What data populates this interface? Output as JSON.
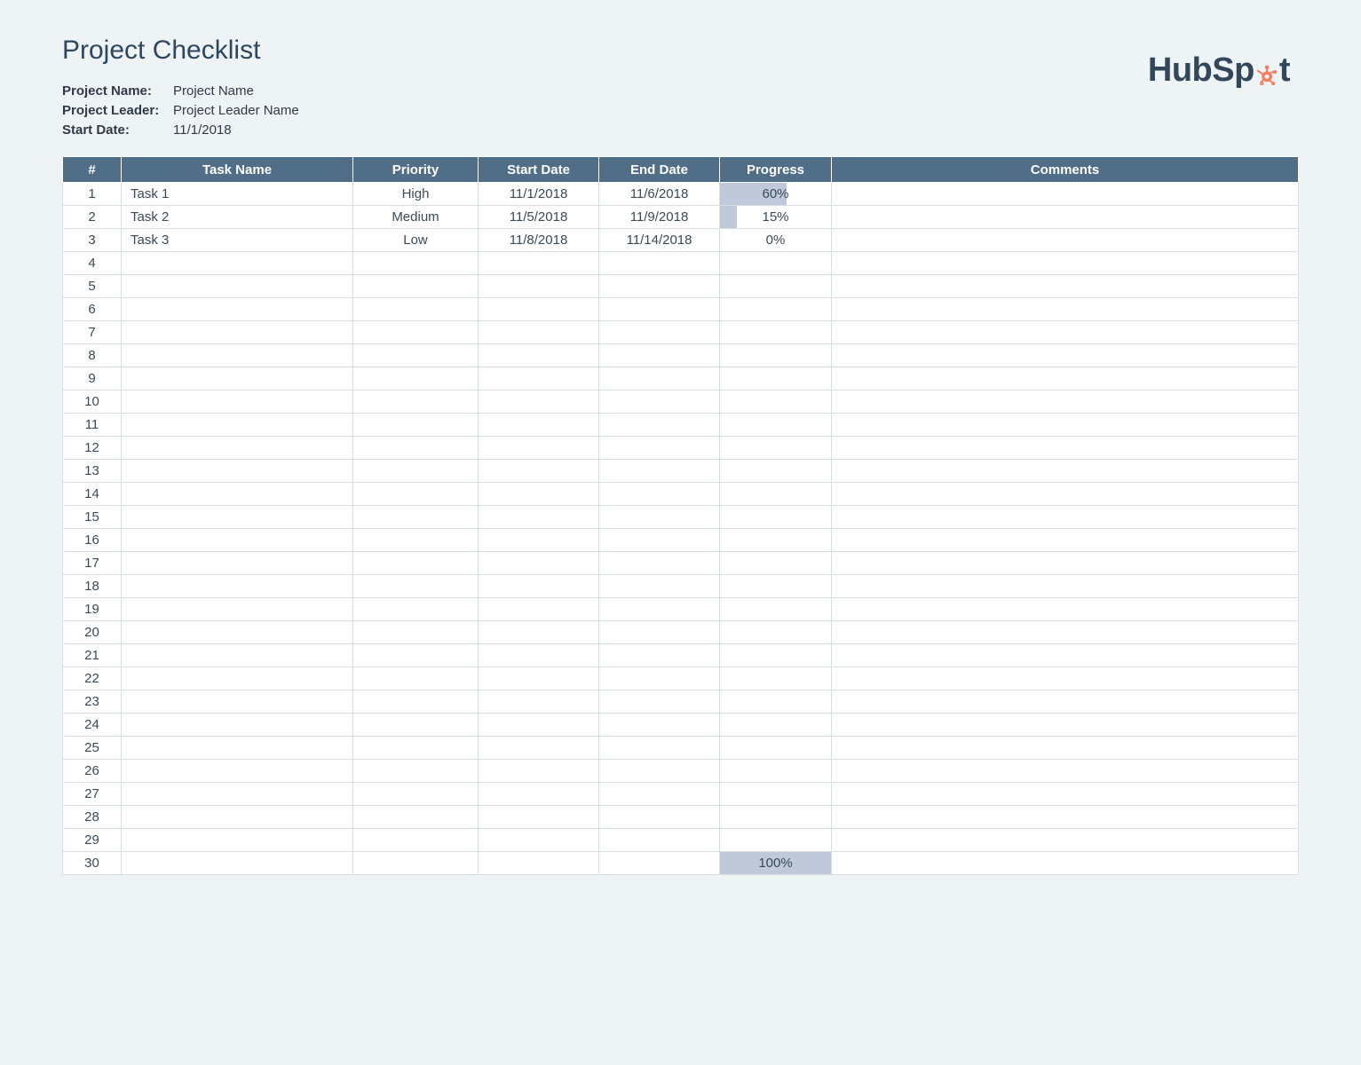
{
  "title": "Project Checklist",
  "meta": {
    "project_name_label": "Project Name:",
    "project_name_value": "Project Name",
    "project_leader_label": "Project Leader:",
    "project_leader_value": "Project Leader Name",
    "start_date_label": "Start Date:",
    "start_date_value": "11/1/2018"
  },
  "logo": {
    "text_left": "HubSp",
    "text_right": "t",
    "accent_color": "#ff7a59",
    "dark_color": "#33475b"
  },
  "columns": {
    "num": "#",
    "task": "Task Name",
    "priority": "Priority",
    "start": "Start Date",
    "end": "End Date",
    "progress": "Progress",
    "comments": "Comments"
  },
  "rows": [
    {
      "num": "1",
      "task": "Task 1",
      "priority": "High",
      "priority_class": "pri-high",
      "start": "11/1/2018",
      "end": "11/6/2018",
      "progress_pct": 60,
      "progress_text": "60%",
      "comments": ""
    },
    {
      "num": "2",
      "task": "Task 2",
      "priority": "Medium",
      "priority_class": "pri-med",
      "start": "11/5/2018",
      "end": "11/9/2018",
      "progress_pct": 15,
      "progress_text": "15%",
      "comments": ""
    },
    {
      "num": "3",
      "task": "Task 3",
      "priority": "Low",
      "priority_class": "pri-low",
      "start": "11/8/2018",
      "end": "11/14/2018",
      "progress_pct": 0,
      "progress_text": "0%",
      "comments": ""
    },
    {
      "num": "4"
    },
    {
      "num": "5"
    },
    {
      "num": "6"
    },
    {
      "num": "7"
    },
    {
      "num": "8"
    },
    {
      "num": "9"
    },
    {
      "num": "10"
    },
    {
      "num": "11"
    },
    {
      "num": "12"
    },
    {
      "num": "13"
    },
    {
      "num": "14"
    },
    {
      "num": "15"
    },
    {
      "num": "16"
    },
    {
      "num": "17"
    },
    {
      "num": "18"
    },
    {
      "num": "19"
    },
    {
      "num": "20"
    },
    {
      "num": "21"
    },
    {
      "num": "22"
    },
    {
      "num": "23"
    },
    {
      "num": "24"
    },
    {
      "num": "25"
    },
    {
      "num": "26"
    },
    {
      "num": "27"
    },
    {
      "num": "28"
    },
    {
      "num": "29"
    },
    {
      "num": "30",
      "progress_pct": 100,
      "progress_text": "100%"
    }
  ]
}
